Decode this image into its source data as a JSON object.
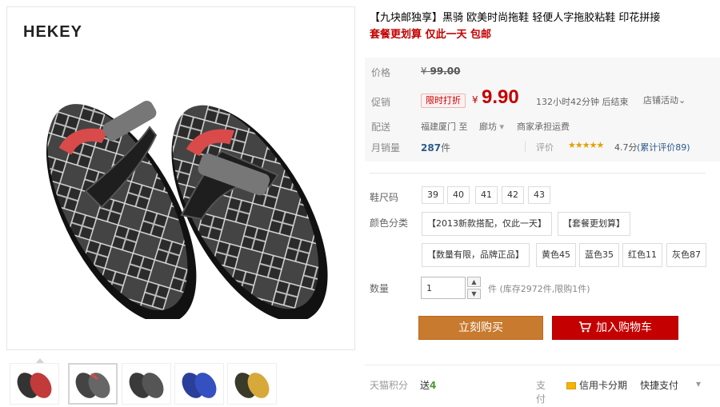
{
  "brand": {
    "logo_text": "HEKEY"
  },
  "product": {
    "title": "【九块邮独享】黑骑 欧美时尚拖鞋 轻便人字拖胶粘鞋 印花拼接",
    "subtitle": "套餐更划算 仅此一天 包邮"
  },
  "price": {
    "label": "价格",
    "currency": "¥",
    "original": "99.00"
  },
  "promo": {
    "label": "促销",
    "badge": "限时打折",
    "currency": "¥",
    "price": "9.90",
    "countdown": "132小时42分钟 后结束",
    "shop_activity": "店铺活动",
    "shop_activity_caret": "⌄"
  },
  "shipping": {
    "label": "配送",
    "from": "福建厦门",
    "to_word": "至",
    "destination": "廊坊",
    "caret": "▾",
    "fee": "商家承担运费"
  },
  "sales": {
    "label": "月销量",
    "count": "287",
    "unit": "件",
    "review_label": "评价",
    "stars": "★★★★★",
    "score": "4.7分",
    "review_link": "(累计评价89)"
  },
  "options": {
    "size_label": "鞋尺码",
    "sizes": [
      "39",
      "40",
      "41",
      "42",
      "43"
    ],
    "color_label": "颜色分类",
    "colors": [
      "【2013新款搭配，仅此一天】",
      "【套餐更划算】",
      "【数量有限，品牌正品】",
      "黄色45",
      "蓝色35",
      "红色11",
      "灰色87"
    ],
    "qty_label": "数量",
    "qty_value": "1",
    "qty_up": "▲",
    "qty_down": "▼",
    "stock_note": "件 (库存2972件,限购1件)"
  },
  "actions": {
    "buy_now": "立刻购买",
    "add_cart": "加入购物车"
  },
  "footer": {
    "points_label": "天猫积分",
    "points_value": "送",
    "points_num": "4",
    "pay_label": "支付",
    "credit_pay": "信用卡分期",
    "quick_pay": "快捷支付",
    "caret": "▾"
  },
  "colors": {
    "accent_red": "#c40000",
    "buy_orange": "#c87a2e",
    "link_blue": "#2b5a8c",
    "star_gold": "#e6a000"
  }
}
